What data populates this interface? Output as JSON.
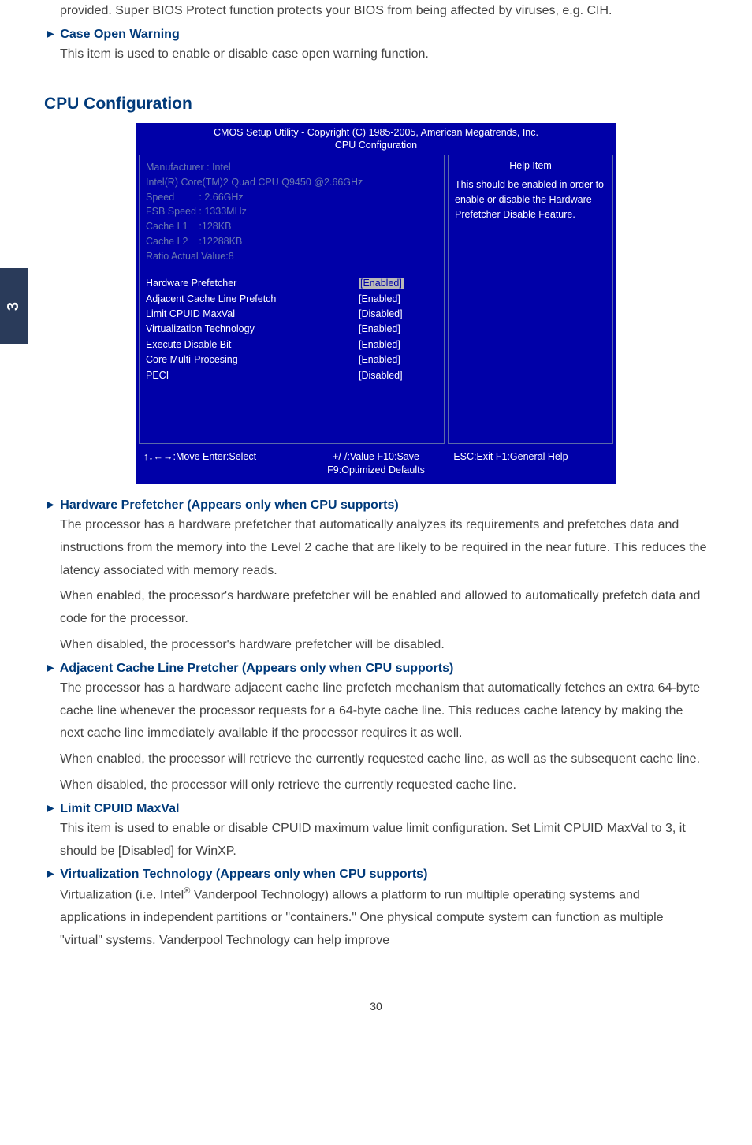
{
  "side_tab": "3",
  "intro": {
    "p1": "provided. Super BIOS Protect function protects your BIOS from being affected by viruses, e.g. CIH.",
    "h1": "► Case Open Warning",
    "p2": "This item is used to enable or disable case open warning function."
  },
  "main_heading": "CPU Configuration",
  "bios": {
    "title_line1": "CMOS Setup Utility - Copyright (C) 1985-2005, American Megatrends, Inc.",
    "title_line2": "CPU Configuration",
    "info": {
      "manufacturer": "Manufacturer : Intel",
      "cpu": "Intel(R) Core(TM)2 Quad CPU Q9450 @2.66GHz",
      "speed": "Speed         : 2.66GHz",
      "fsb": "FSB Speed : 1333MHz",
      "l1": "Cache L1    :128KB",
      "l2": "Cache L2    :12288KB",
      "ratio": "Ratio Actual Value:8"
    },
    "settings": [
      {
        "label": "Hardware Prefetcher",
        "value": "[Enabled]",
        "highlight": true
      },
      {
        "label": "Adjacent Cache Line Prefetch",
        "value": "[Enabled]",
        "highlight": false
      },
      {
        "label": "Limit CPUID MaxVal",
        "value": "[Disabled]",
        "highlight": false
      },
      {
        "label": "Virtualization Technology",
        "value": "[Enabled]",
        "highlight": false
      },
      {
        "label": "Execute Disable Bit",
        "value": "[Enabled]",
        "highlight": false
      },
      {
        "label": "Core Multi-Procesing",
        "value": "[Enabled]",
        "highlight": false
      },
      {
        "label": "PECI",
        "value": "[Disabled]",
        "highlight": false
      }
    ],
    "help_title": "Help Item",
    "help_text": "This should be enabled in order to enable or disable the Hardware Prefetcher Disable Feature.",
    "footer": {
      "c1a": "↑↓←→:Move   Enter:Select",
      "c2a": "+/-/:Value    F10:Save",
      "c2b": "F9:Optimized Defaults",
      "c3a": "ESC:Exit    F1:General Help"
    }
  },
  "sections": {
    "hw_pref": {
      "h": "► Hardware Prefetcher (Appears only when CPU supports)",
      "p1": "The processor has a hardware prefetcher that automatically analyzes its requirements and prefetches data and instructions from the memory into the Level 2 cache that are likely to be required in the near future. This reduces the latency associated with memory reads.",
      "p2": "When enabled, the processor's hardware prefetcher will be enabled and allowed to automatically prefetch data and code for the processor.",
      "p3": "When disabled, the processor's hardware prefetcher will be disabled."
    },
    "adj": {
      "h": "► Adjacent Cache Line Pretcher (Appears only when CPU supports)",
      "p1": "The processor has a hardware adjacent cache line prefetch mechanism that automatically fetches an extra 64-byte cache line whenever the processor requests for a 64-byte cache line. This reduces cache latency by making the next cache line immediately available if the processor requires it as well.",
      "p2": "When enabled, the processor will retrieve the currently requested cache line, as well as the subsequent cache line.",
      "p3": "When disabled, the processor will only retrieve the currently requested cache line."
    },
    "cpuid": {
      "h": "► Limit CPUID MaxVal",
      "p1": "This item is used to enable or disable CPUID maximum value limit configuration. Set Limit CPUID MaxVal to 3, it should be [Disabled] for WinXP."
    },
    "virt": {
      "h": "► Virtualization Technology  (Appears only when CPU supports)",
      "p1a": "Virtualization (i.e. Intel",
      "p1b": " Vanderpool Technology) allows a platform to run multiple operating systems and applications in independent partitions or \"containers.\" One physical compute system can function as multiple \"virtual\" systems. Vanderpool Technology can help improve"
    }
  },
  "page_num": "30"
}
